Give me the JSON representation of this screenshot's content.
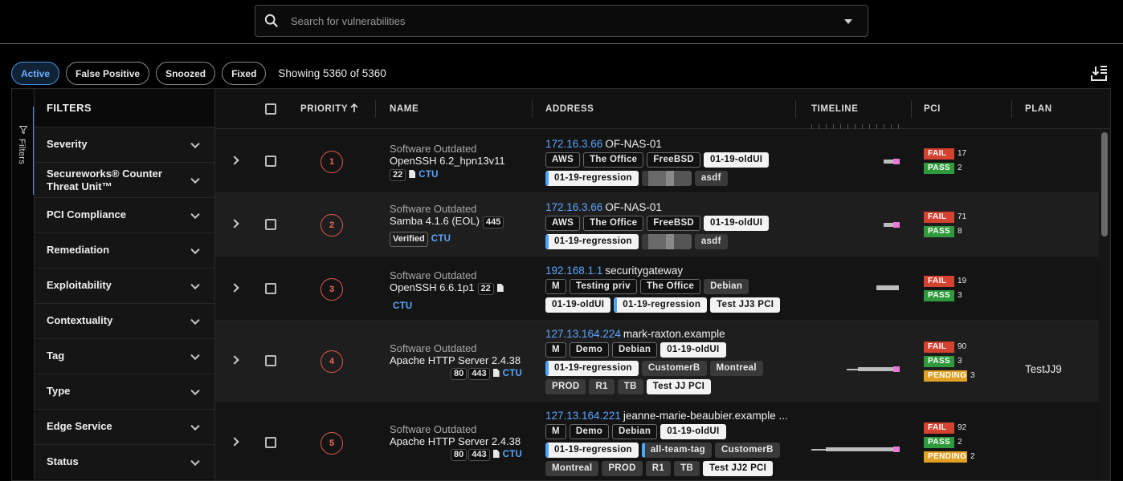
{
  "search": {
    "placeholder": "Search for vulnerabilities"
  },
  "status_tabs": [
    "Active",
    "False Positive",
    "Snoozed",
    "Fixed"
  ],
  "showing": "Showing 5360 of 5360",
  "sidebar": {
    "rail_label": "Filters",
    "title": "FILTERS",
    "items": [
      "Severity",
      "Secureworks® Counter Threat Unit™",
      "PCI Compliance",
      "Remediation",
      "Exploitability",
      "Contextuality",
      "Tag",
      "Type",
      "Edge Service",
      "Status"
    ]
  },
  "columns": {
    "priority": "PRIORITY",
    "name": "NAME",
    "address": "ADDRESS",
    "timeline": "TIMELINE",
    "pci": "PCI",
    "plan": "PLAN"
  },
  "rows": [
    {
      "priority": "1",
      "category": "Software Outdated",
      "product": "OpenSSH 6.2_hpn13v11",
      "ports": [
        "22"
      ],
      "verified": "",
      "ctu": "CTU",
      "ip": "172.16.3.66",
      "host": "OF-NAS-01",
      "tags": [
        {
          "t": "AWS",
          "s": "o"
        },
        {
          "t": "The Office",
          "s": "o"
        },
        {
          "t": "FreeBSD",
          "s": "o"
        },
        {
          "t": "01-19-oldUI",
          "s": "w"
        },
        {
          "t": "01-19-regression",
          "s": "wb"
        },
        {
          "t": "",
          "s": "blur"
        },
        {
          "t": "asdf",
          "s": "g"
        }
      ],
      "pci": [
        {
          "label": "FAIL",
          "count": "17"
        },
        {
          "label": "PASS",
          "count": "2"
        }
      ],
      "plan": ""
    },
    {
      "priority": "2",
      "category": "Software Outdated",
      "product": "Samba 4.1.6 (EOL)",
      "ports": [
        "445"
      ],
      "verified": "Verified",
      "ctu": "CTU",
      "ip": "172.16.3.66",
      "host": "OF-NAS-01",
      "tags": [
        {
          "t": "AWS",
          "s": "o"
        },
        {
          "t": "The Office",
          "s": "o"
        },
        {
          "t": "FreeBSD",
          "s": "o"
        },
        {
          "t": "01-19-oldUI",
          "s": "w"
        },
        {
          "t": "01-19-regression",
          "s": "wb"
        },
        {
          "t": "",
          "s": "blur"
        },
        {
          "t": "asdf",
          "s": "g"
        }
      ],
      "pci": [
        {
          "label": "FAIL",
          "count": "71"
        },
        {
          "label": "PASS",
          "count": "8"
        }
      ],
      "plan": ""
    },
    {
      "priority": "3",
      "category": "Software Outdated",
      "product": "OpenSSH 6.6.1p1",
      "ports": [
        "22"
      ],
      "verified": "",
      "ctu": "CTU",
      "ip": "192.168.1.1",
      "host": "securitygateway",
      "tags": [
        {
          "t": "M",
          "s": "o"
        },
        {
          "t": "Testing priv",
          "s": "o"
        },
        {
          "t": "The Office",
          "s": "o"
        },
        {
          "t": "Debian",
          "s": "g"
        },
        {
          "t": "01-19-oldUI",
          "s": "w"
        },
        {
          "t": "01-19-regression",
          "s": "wb"
        },
        {
          "t": "Test JJ3 PCI",
          "s": "w"
        }
      ],
      "pci": [
        {
          "label": "FAIL",
          "count": "19"
        },
        {
          "label": "PASS",
          "count": "3"
        }
      ],
      "plan": ""
    },
    {
      "priority": "4",
      "category": "Software Outdated",
      "product": "Apache HTTP Server 2.4.38",
      "ports": [
        "80",
        "443"
      ],
      "verified": "",
      "ctu": "CTU",
      "ip": "127.13.164.224",
      "host": "mark-raxton.example",
      "tags": [
        {
          "t": "M",
          "s": "o"
        },
        {
          "t": "Demo",
          "s": "o"
        },
        {
          "t": "Debian",
          "s": "o"
        },
        {
          "t": "01-19-oldUI",
          "s": "w"
        },
        {
          "t": "01-19-regression",
          "s": "wb"
        },
        {
          "t": "CustomerB",
          "s": "g"
        },
        {
          "t": "Montreal",
          "s": "g"
        },
        {
          "t": "PROD",
          "s": "g"
        },
        {
          "t": "R1",
          "s": "g"
        },
        {
          "t": "TB",
          "s": "g"
        },
        {
          "t": "Test JJ PCI",
          "s": "w"
        }
      ],
      "pci": [
        {
          "label": "FAIL",
          "count": "90"
        },
        {
          "label": "PASS",
          "count": "3"
        },
        {
          "label": "PENDING",
          "count": "3"
        }
      ],
      "plan": "TestJJ9"
    },
    {
      "priority": "5",
      "category": "Software Outdated",
      "product": "Apache HTTP Server 2.4.38",
      "ports": [
        "80",
        "443"
      ],
      "verified": "",
      "ctu": "CTU",
      "ip": "127.13.164.221",
      "host": "jeanne-marie-beaubier.example ...",
      "tags": [
        {
          "t": "M",
          "s": "o"
        },
        {
          "t": "Demo",
          "s": "o"
        },
        {
          "t": "Debian",
          "s": "o"
        },
        {
          "t": "01-19-oldUI",
          "s": "w"
        },
        {
          "t": "01-19-regression",
          "s": "wb"
        },
        {
          "t": "all-team-tag",
          "s": "gb"
        },
        {
          "t": "CustomerB",
          "s": "g"
        },
        {
          "t": "Montreal",
          "s": "g"
        },
        {
          "t": "PROD",
          "s": "g"
        },
        {
          "t": "R1",
          "s": "g"
        },
        {
          "t": "TB",
          "s": "g"
        },
        {
          "t": "Test JJ2 PCI",
          "s": "w"
        }
      ],
      "pci": [
        {
          "label": "FAIL",
          "count": "92"
        },
        {
          "label": "PASS",
          "count": "2"
        },
        {
          "label": "PENDING",
          "count": "2"
        }
      ],
      "plan": ""
    }
  ]
}
